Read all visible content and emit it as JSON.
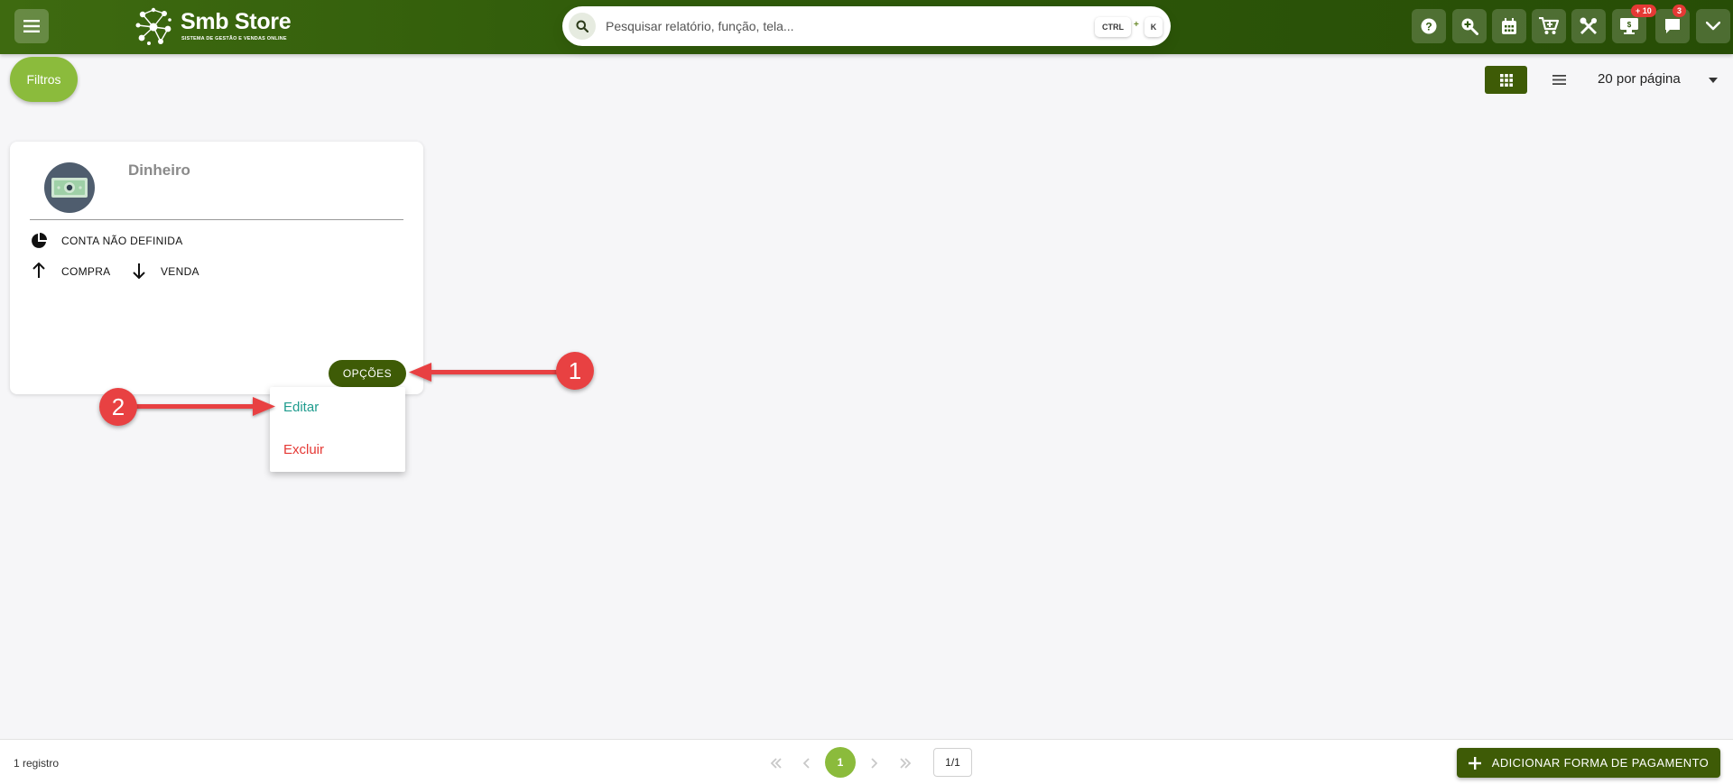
{
  "header": {
    "logo_title": "Smb Store",
    "logo_subtitle": "SISTEMA DE GESTÃO E VENDAS ONLINE",
    "search_placeholder": "Pesquisar relatório, função, tela...",
    "shortcut_ctrl": "CTRL",
    "shortcut_plus": "+",
    "shortcut_key": "K",
    "icons": [
      "help-icon",
      "zoom-search-icon",
      "calendar-icon",
      "cart-icon",
      "tools-icon",
      "monitor-icon",
      "chat-icon",
      "chevron-down-icon"
    ],
    "monitor_badge": "+ 10",
    "chat_badge": "3"
  },
  "toolbar": {
    "filter_label": "Filtros",
    "per_page_label": "20 por página"
  },
  "card": {
    "title": "Dinheiro",
    "account": "CONTA NÃO DEFINIDA",
    "purchase": "COMPRA",
    "sale": "VENDA",
    "options_label": "OPÇÕES"
  },
  "dropdown": {
    "edit": "Editar",
    "delete": "Excluir"
  },
  "annotations": {
    "step1": "1",
    "step2": "2",
    "color": "#e84142"
  },
  "footer": {
    "records": "1 registro",
    "current_page": "1",
    "page_total": "1/1",
    "add_button": "ADICIONAR FORMA DE PAGAMENTO"
  },
  "colors": {
    "brand_dark": "#3e5b06",
    "brand_light": "#8bbb3c",
    "edit": "#1f9c8e",
    "delete": "#e53935"
  }
}
